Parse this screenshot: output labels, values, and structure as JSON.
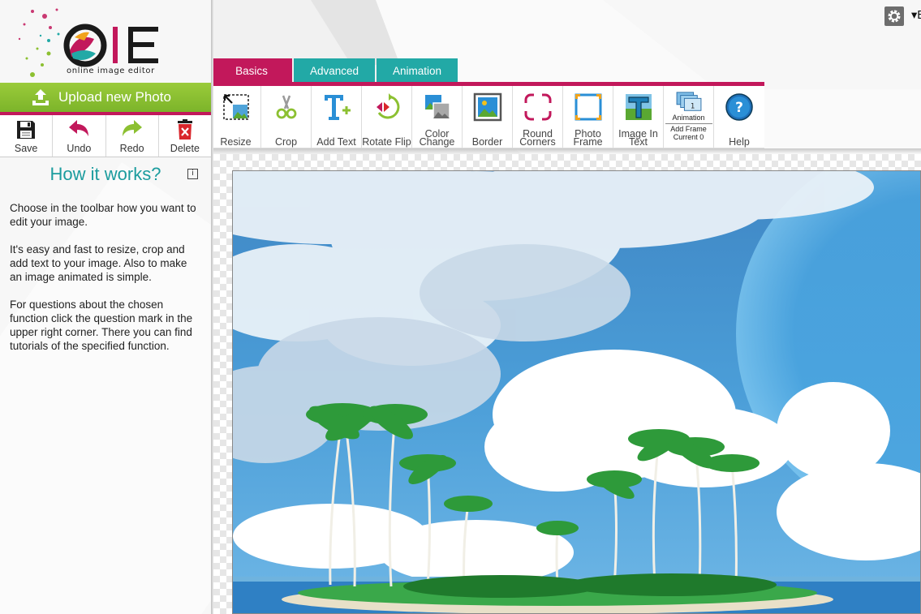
{
  "logo": {
    "letters": "IE",
    "tagline": "online image editor"
  },
  "upload": {
    "label": "Upload new Photo"
  },
  "file_tools": [
    {
      "label": "Save",
      "icon": "floppy-disk-icon"
    },
    {
      "label": "Undo",
      "icon": "undo-arrow-icon"
    },
    {
      "label": "Redo",
      "icon": "redo-arrow-icon"
    },
    {
      "label": "Delete",
      "icon": "trash-icon"
    }
  ],
  "how": {
    "title": "How it works?",
    "info": "i",
    "paragraphs": [
      "Choose in the toolbar how you want to edit your image.",
      "It's easy and fast to resize, crop and add text to your image. Also to make an image animated is simple.",
      "For questions about the chosen function click the question mark in the upper right corner. There you can find tutorials of the specified function."
    ]
  },
  "header": {
    "language": "▾English"
  },
  "tabs": [
    {
      "label": "Basics",
      "active": true
    },
    {
      "label": "Advanced",
      "active": false
    },
    {
      "label": "Animation",
      "active": false
    }
  ],
  "tools": [
    {
      "label": "Resize"
    },
    {
      "label": "Crop"
    },
    {
      "label": "Add Text"
    },
    {
      "label": "Rotate Flip"
    },
    {
      "label": "Color Change"
    },
    {
      "label": "Border"
    },
    {
      "label": "Round Corners"
    },
    {
      "label": "Photo Frame"
    },
    {
      "label": "Image In Text"
    },
    {
      "label": "Animation",
      "sub1": "Add Frame",
      "sub2": "Current 0",
      "frame_number": "1"
    },
    {
      "label": "Help"
    }
  ],
  "colors": {
    "accent": "#c2185b",
    "teal": "#22a9a6",
    "green": "#8cc031",
    "title": "#1b9c9e"
  }
}
